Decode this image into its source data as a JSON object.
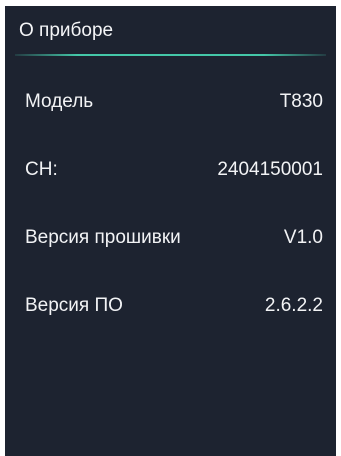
{
  "screen": {
    "title": "О приборе",
    "accent_color": "#44c7a8",
    "background_color": "#1d2330"
  },
  "info": {
    "rows": [
      {
        "label": "Модель",
        "value": "T830"
      },
      {
        "label": "СН:",
        "value": "2404150001"
      },
      {
        "label": "Версия прошивки",
        "value": "V1.0"
      },
      {
        "label": "Версия ПО",
        "value": "2.6.2.2"
      }
    ]
  }
}
